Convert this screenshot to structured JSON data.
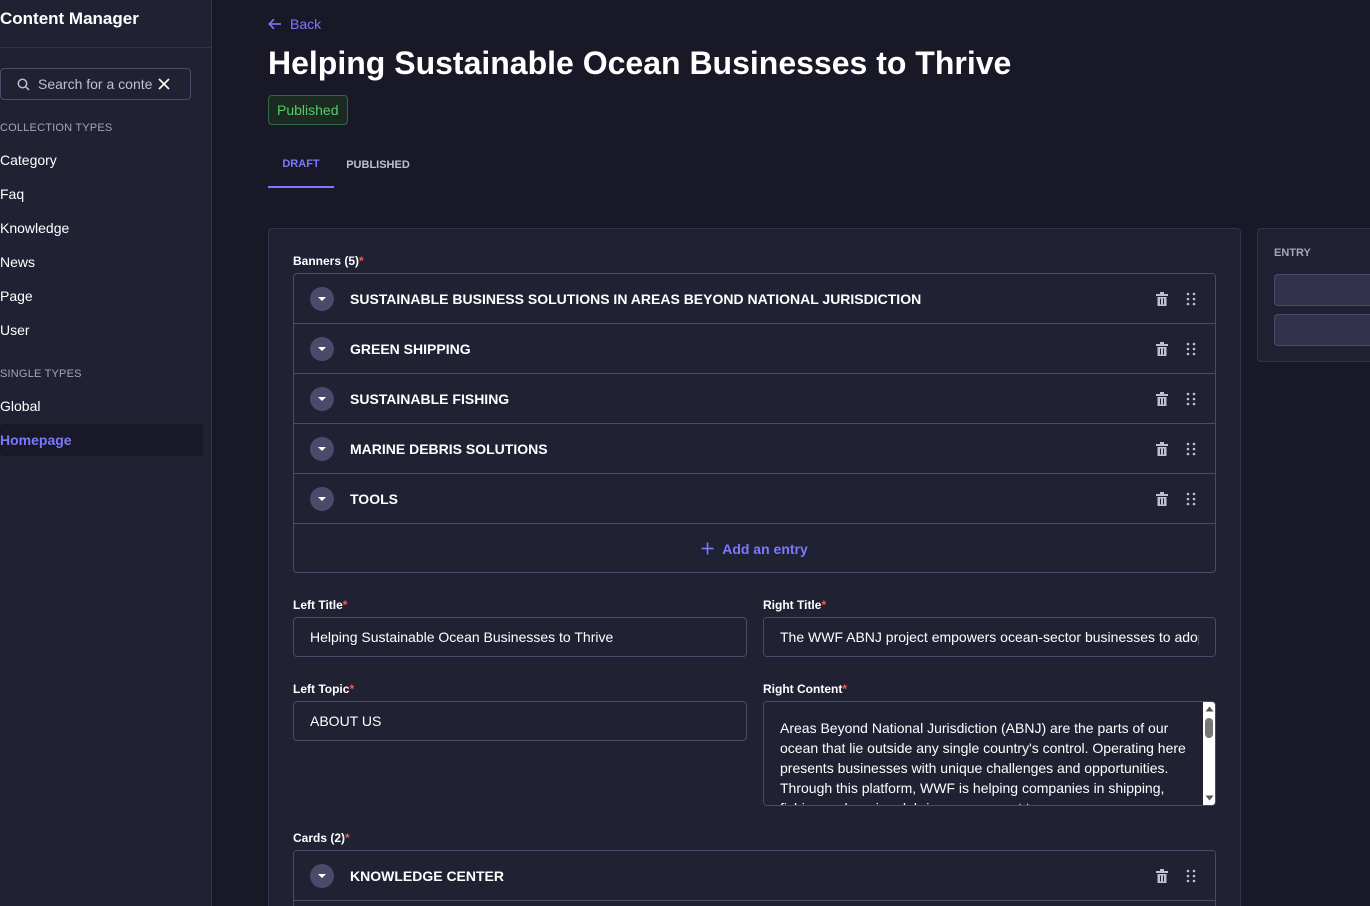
{
  "sidebar": {
    "title": "Content Manager",
    "search": {
      "placeholder": "Search for a content type",
      "value": ""
    },
    "collection_label": "COLLECTION TYPES",
    "collection_items": [
      "Category",
      "Faq",
      "Knowledge",
      "News",
      "Page",
      "User"
    ],
    "single_label": "SINGLE TYPES",
    "single_items": [
      "Global",
      "Homepage"
    ],
    "active_item": "Homepage"
  },
  "header": {
    "back_label": "Back",
    "title": "Helping Sustainable Ocean Businesses to Thrive",
    "status": "Published",
    "tabs": [
      "DRAFT",
      "PUBLISHED"
    ],
    "active_tab": "DRAFT"
  },
  "banners": {
    "label": "Banners (5)",
    "required_mark": "*",
    "items": [
      "SUSTAINABLE BUSINESS SOLUTIONS IN AREAS BEYOND NATIONAL JURISDICTION",
      "GREEN SHIPPING",
      "SUSTAINABLE FISHING",
      "MARINE DEBRIS SOLUTIONS",
      "TOOLS"
    ],
    "add_label": "Add an entry"
  },
  "fields": {
    "left_title": {
      "label": "Left Title",
      "value": "Helping Sustainable Ocean Businesses to Thrive"
    },
    "right_title": {
      "label": "Right Title",
      "value": "The WWF ABNJ project empowers ocean-sector businesses to adopt"
    },
    "left_topic": {
      "label": "Left Topic",
      "value": "ABOUT US"
    },
    "right_content": {
      "label": "Right Content",
      "value": "Areas Beyond National Jurisdiction (ABNJ) are the parts of our ocean that lie outside any single country's control. Operating here presents businesses with unique challenges and opportunities. Through this platform, WWF is helping companies in shipping, fishing and marine debris management to"
    }
  },
  "cards": {
    "label": "Cards (2)",
    "items": [
      "KNOWLEDGE CENTER"
    ]
  },
  "side_panel": {
    "label": "ENTRY"
  },
  "colors": {
    "accent": "#7b79ff",
    "published": "#55cb6e",
    "required": "#ee5e52",
    "background": "#181826",
    "panel": "#212134"
  }
}
